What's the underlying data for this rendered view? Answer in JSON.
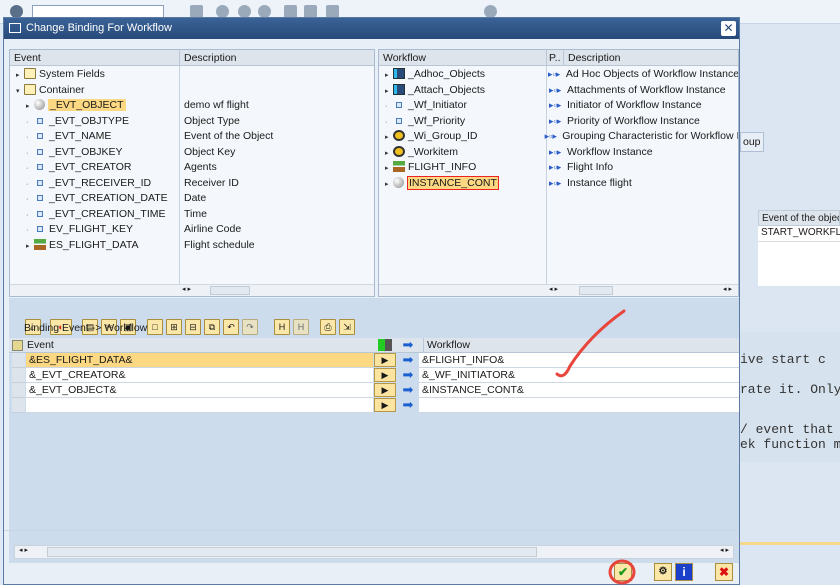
{
  "dialog": {
    "title": "Change Binding For Workflow",
    "close_icon": "close-icon"
  },
  "event_tree": {
    "headers": [
      "Event",
      "Description"
    ],
    "rows": [
      {
        "name": "System Fields",
        "desc": "",
        "icon": "folder-icon",
        "level": 0,
        "expand": "collapsed"
      },
      {
        "name": "Container",
        "desc": "",
        "icon": "folder-open-icon",
        "level": 0,
        "expand": "expanded"
      },
      {
        "name": "_EVT_OBJECT",
        "desc": "demo wf flight",
        "icon": "object-icon",
        "level": 1,
        "expand": "collapsed",
        "highlight": true
      },
      {
        "name": "_EVT_OBJTYPE",
        "desc": "Object Type",
        "icon": "element-icon",
        "level": 1
      },
      {
        "name": "_EVT_NAME",
        "desc": "Event of the Object",
        "icon": "element-icon",
        "level": 1
      },
      {
        "name": "_EVT_OBJKEY",
        "desc": "Object Key",
        "icon": "element-icon",
        "level": 1
      },
      {
        "name": "_EVT_CREATOR",
        "desc": "Agents",
        "icon": "element-icon",
        "level": 1
      },
      {
        "name": "_EVT_RECEIVER_ID",
        "desc": "Receiver ID",
        "icon": "element-icon",
        "level": 1
      },
      {
        "name": "_EVT_CREATION_DATE",
        "desc": "Date",
        "icon": "element-icon",
        "level": 1
      },
      {
        "name": "_EVT_CREATION_TIME",
        "desc": "Time",
        "icon": "element-icon",
        "level": 1
      },
      {
        "name": "EV_FLIGHT_KEY",
        "desc": "Airline Code",
        "icon": "element-icon",
        "level": 1
      },
      {
        "name": "ES_FLIGHT_DATA",
        "desc": "Flight schedule",
        "icon": "structure-icon",
        "level": 1,
        "expand": "collapsed"
      }
    ]
  },
  "workflow_tree": {
    "headers": [
      "Workflow",
      "P..",
      "Description"
    ],
    "rows": [
      {
        "name": "_Adhoc_Objects",
        "desc": "Ad Hoc Objects of Workflow Instance",
        "icon": "table-icon"
      },
      {
        "name": "_Attach_Objects",
        "desc": "Attachments of Workflow Instance",
        "icon": "table-icon"
      },
      {
        "name": "_Wf_Initiator",
        "desc": "Initiator of Workflow Instance",
        "icon": "element-icon"
      },
      {
        "name": "_Wf_Priority",
        "desc": "Priority of Workflow Instance",
        "icon": "element-icon"
      },
      {
        "name": "_Wi_Group_ID",
        "desc": "Grouping Characteristic for Workflow Ir",
        "icon": "workitem-icon"
      },
      {
        "name": "_Workitem",
        "desc": "Workflow Instance",
        "icon": "workitem-icon"
      },
      {
        "name": "FLIGHT_INFO",
        "desc": "Flight Info",
        "icon": "structure-icon"
      },
      {
        "name": "INSTANCE_CONT",
        "desc": "Instance flight",
        "icon": "object-icon",
        "highlight": true
      }
    ]
  },
  "binding": {
    "title": "Binding Event  -> Workflow",
    "headers": {
      "event": "Event",
      "workflow": "Workflow"
    },
    "rows": [
      {
        "event": "&ES_FLIGHT_DATA&",
        "workflow": "&FLIGHT_INFO&"
      },
      {
        "event": "&_EVT_CREATOR&",
        "workflow": "&_WF_INITIATOR&"
      },
      {
        "event": "&_EVT_OBJECT&",
        "workflow": "&INSTANCE_CONT&"
      },
      {
        "event": "",
        "workflow": ""
      }
    ]
  },
  "background": {
    "tab_fragment": "oup",
    "col_header": "Event of the objec",
    "col_value": "START_WORKFLO",
    "text_lines": [
      "ive start c",
      "rate it. Only",
      "/ event that h",
      "ek function mo"
    ]
  },
  "colors": {
    "title_bar": "#27497a",
    "highlight": "#fcd882",
    "annotation": "#e8453c"
  }
}
